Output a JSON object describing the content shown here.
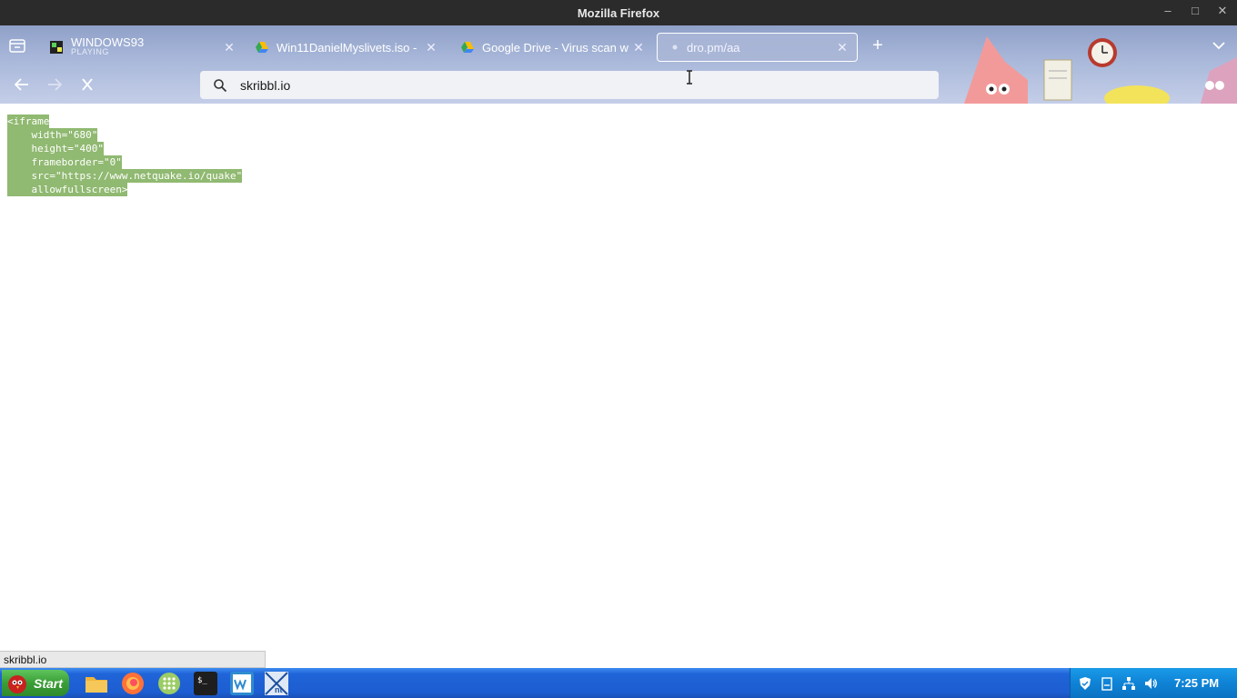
{
  "window": {
    "title": "Mozilla Firefox"
  },
  "tabs": [
    {
      "label": "WINDOWS93",
      "sublabel": "PLAYING",
      "icon": "windows93-icon"
    },
    {
      "label": "Win11DanielMyslivets.iso - ",
      "icon": "google-drive-icon"
    },
    {
      "label": "Google Drive - Virus scan w",
      "icon": "google-drive-icon"
    },
    {
      "label": "dro.pm/aa",
      "icon": "loading-dot-icon",
      "active": true
    }
  ],
  "urlbar": {
    "value": "skribbl.io"
  },
  "page": {
    "code_lines": [
      "<iframe",
      "    width=\"680\"",
      "    height=\"400\"",
      "    frameborder=\"0\"",
      "    src=\"https://www.netquake.io/quake\"",
      "    allowfullscreen>"
    ],
    "selection_color": "#90b971"
  },
  "statusbar": {
    "text": "skribbl.io"
  },
  "taskbar": {
    "start_label": "Start",
    "clock": "7:25 PM",
    "apps": [
      "files-icon",
      "firefox-icon",
      "apps-grid-icon",
      "terminal-icon",
      "editor-icon",
      "network-tool-icon"
    ]
  }
}
